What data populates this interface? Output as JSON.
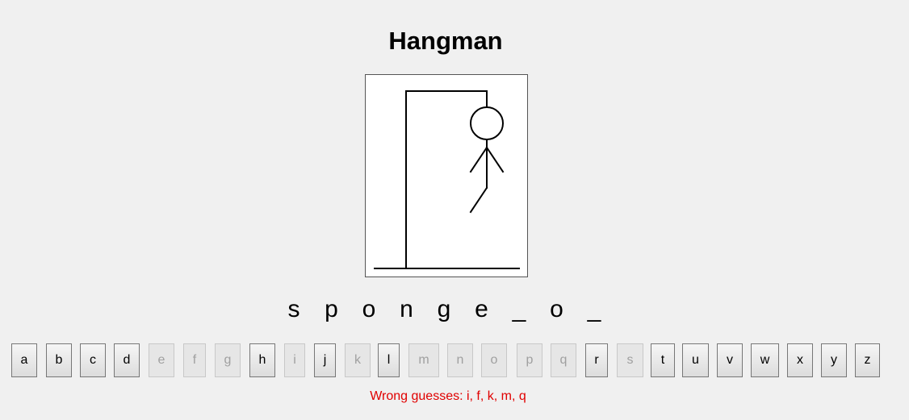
{
  "title": "Hangman",
  "word": [
    "s",
    "p",
    "o",
    "n",
    "g",
    "e",
    "_",
    "o",
    "_"
  ],
  "keyboard": [
    {
      "letter": "a",
      "used": false
    },
    {
      "letter": "b",
      "used": false
    },
    {
      "letter": "c",
      "used": false
    },
    {
      "letter": "d",
      "used": false
    },
    {
      "letter": "e",
      "used": true
    },
    {
      "letter": "f",
      "used": true
    },
    {
      "letter": "g",
      "used": true
    },
    {
      "letter": "h",
      "used": false
    },
    {
      "letter": "i",
      "used": true
    },
    {
      "letter": "j",
      "used": false
    },
    {
      "letter": "k",
      "used": true
    },
    {
      "letter": "l",
      "used": false
    },
    {
      "letter": "m",
      "used": true
    },
    {
      "letter": "n",
      "used": true
    },
    {
      "letter": "o",
      "used": true
    },
    {
      "letter": "p",
      "used": true
    },
    {
      "letter": "q",
      "used": true
    },
    {
      "letter": "r",
      "used": false
    },
    {
      "letter": "s",
      "used": true
    },
    {
      "letter": "t",
      "used": false
    },
    {
      "letter": "u",
      "used": false
    },
    {
      "letter": "v",
      "used": false
    },
    {
      "letter": "w",
      "used": false
    },
    {
      "letter": "x",
      "used": false
    },
    {
      "letter": "y",
      "used": false
    },
    {
      "letter": "z",
      "used": false
    }
  ],
  "wrong_guesses_text": "Wrong guesses: i, f, k, m, q",
  "wrong_guess_count": 5,
  "colors": {
    "background": "#f0f0f0",
    "wrong_text": "#e00000",
    "used_key_text": "#a0a0a0"
  }
}
